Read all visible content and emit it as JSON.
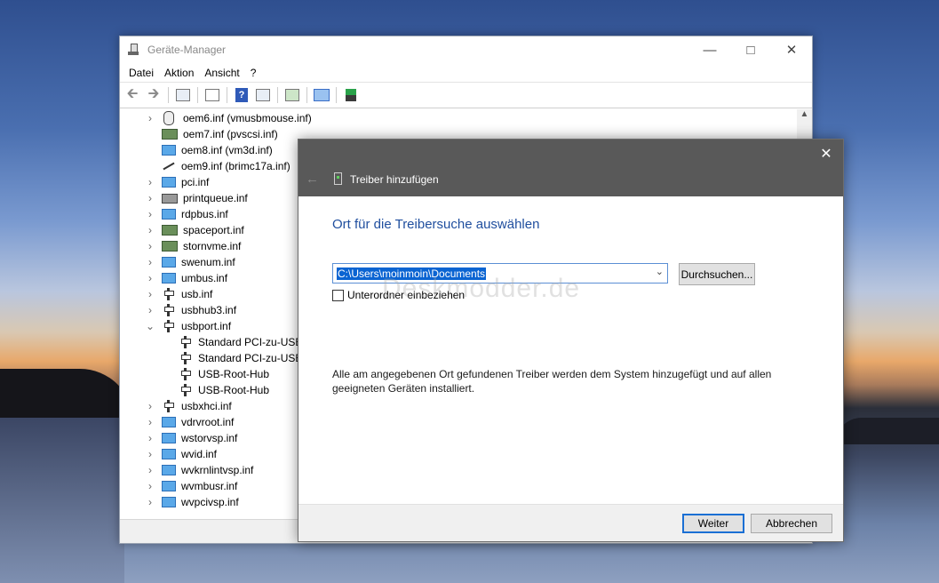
{
  "device_manager": {
    "title": "Geräte-Manager",
    "menu": [
      "Datei",
      "Aktion",
      "Ansicht",
      "?"
    ],
    "tree": [
      {
        "label": "oem6.inf (vmusbmouse.inf)",
        "icon": "mouse-icon",
        "chevron": "right",
        "level": 0
      },
      {
        "label": "oem7.inf (pvscsi.inf)",
        "icon": "storage-controller-icon",
        "chevron": "none",
        "level": 0
      },
      {
        "label": "oem8.inf (vm3d.inf)",
        "icon": "display-adapter-icon",
        "chevron": "none",
        "level": 0
      },
      {
        "label": "oem9.inf (brimc17a.inf)",
        "icon": "cable-icon",
        "chevron": "none",
        "level": 0
      },
      {
        "label": "pci.inf",
        "icon": "network-folder-icon",
        "chevron": "right",
        "level": 0
      },
      {
        "label": "printqueue.inf",
        "icon": "printer-icon",
        "chevron": "right",
        "level": 0
      },
      {
        "label": "rdpbus.inf",
        "icon": "network-folder-icon",
        "chevron": "right",
        "level": 0
      },
      {
        "label": "spaceport.inf",
        "icon": "storage-controller-icon",
        "chevron": "right",
        "level": 0
      },
      {
        "label": "stornvme.inf",
        "icon": "storage-controller-icon",
        "chevron": "right",
        "level": 0
      },
      {
        "label": "swenum.inf",
        "icon": "network-folder-icon",
        "chevron": "right",
        "level": 0
      },
      {
        "label": "umbus.inf",
        "icon": "network-folder-icon",
        "chevron": "right",
        "level": 0
      },
      {
        "label": "usb.inf",
        "icon": "usb-icon",
        "chevron": "right",
        "level": 0
      },
      {
        "label": "usbhub3.inf",
        "icon": "usb-icon",
        "chevron": "right",
        "level": 0
      },
      {
        "label": "usbport.inf",
        "icon": "usb-icon",
        "chevron": "down",
        "level": 0
      },
      {
        "label": "Standard PCI-zu-USB",
        "icon": "usb-icon",
        "chevron": "none",
        "level": 1
      },
      {
        "label": "Standard PCI-zu-USB",
        "icon": "usb-icon",
        "chevron": "none",
        "level": 1
      },
      {
        "label": "USB-Root-Hub",
        "icon": "usb-icon",
        "chevron": "none",
        "level": 1
      },
      {
        "label": "USB-Root-Hub",
        "icon": "usb-icon",
        "chevron": "none",
        "level": 1
      },
      {
        "label": "usbxhci.inf",
        "icon": "usb-icon",
        "chevron": "right",
        "level": 0
      },
      {
        "label": "vdrvroot.inf",
        "icon": "network-folder-icon",
        "chevron": "right",
        "level": 0
      },
      {
        "label": "wstorvsp.inf",
        "icon": "network-folder-icon",
        "chevron": "right",
        "level": 0
      },
      {
        "label": "wvid.inf",
        "icon": "network-folder-icon",
        "chevron": "right",
        "level": 0
      },
      {
        "label": "wvkrnlintvsp.inf",
        "icon": "network-folder-icon",
        "chevron": "right",
        "level": 0
      },
      {
        "label": "wvmbusr.inf",
        "icon": "network-folder-icon",
        "chevron": "right",
        "level": 0
      },
      {
        "label": "wvpcivsp.inf",
        "icon": "network-folder-icon",
        "chevron": "right",
        "level": 0
      }
    ]
  },
  "dialog": {
    "title": "Treiber hinzufügen",
    "heading": "Ort für die Treibersuche auswählen",
    "path_value": "C:\\Users\\moinmoin\\Documents",
    "browse_label": "Durchsuchen...",
    "checkbox_label": "Unterordner einbeziehen",
    "checkbox_checked": false,
    "description": "Alle am angegebenen Ort gefundenen Treiber werden dem System hinzugefügt und auf allen geeigneten Geräten installiert.",
    "next_label": "Weiter",
    "cancel_label": "Abbrechen"
  },
  "watermark": "Deskmodder.de",
  "colors": {
    "heading_blue": "#1f4e9e",
    "selection_blue": "#0a64d2",
    "dialog_header": "#595959"
  }
}
